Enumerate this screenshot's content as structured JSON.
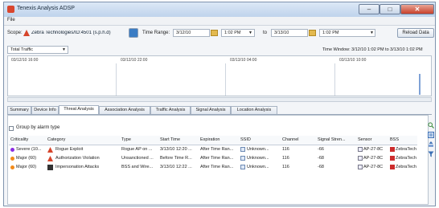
{
  "window": {
    "title": "Tenexis Analysis ADSP"
  },
  "menu": {
    "file": "File"
  },
  "toolbar": {
    "scope_label": "Scope:",
    "scope_value": "Zebra Technologies/ID:4501 (s.p.h.d)",
    "time_range_label": "Time Range:",
    "from_date": "3/12/10",
    "from_time": "1:02 PM",
    "to_label": "to",
    "to_date": "3/13/10",
    "to_time": "1:02 PM",
    "reload_label": "Reload Data"
  },
  "filter": {
    "value": "Total Traffic"
  },
  "time_window": "Time Window: 3/12/10 1:02 PM to 3/13/10 1:02 PM",
  "timeline": {
    "ticks": [
      "03/12/10 16:00",
      "03/12/10 22:00",
      "03/13/10 04:00",
      "03/13/10 10:00"
    ]
  },
  "tabs": [
    "Summary",
    "Device Info",
    "Threat Analysis",
    "Association Analysis",
    "Traffic Analysis",
    "Signal Analysis",
    "Location Analysis"
  ],
  "group_by": "Group by alarm type",
  "table": {
    "columns": [
      "Criticality",
      "Category",
      "Type",
      "Start Time",
      "Expiration",
      "SSID",
      "Channel",
      "Signal Stren...",
      "Sensor",
      "BSS"
    ],
    "rows": [
      {
        "criticality": "Severe (10...",
        "category": "Rogue Exploit",
        "type": "Rogue AP on ...",
        "start": "3/13/10 12:20 ...",
        "expiration": "After Time Ran...",
        "ssid": "Unknown...",
        "channel": "116",
        "signal": "-66",
        "sensor": "AP-27-8C",
        "bss": "ZebraTech"
      },
      {
        "criticality": "Major (60)",
        "category": "Authorization Violation",
        "type": "Unsanctioned ...",
        "start": "Before Time R...",
        "expiration": "After Time Ran...",
        "ssid": "Unknown...",
        "channel": "116",
        "signal": "-68",
        "sensor": "AP-27-8C",
        "bss": "ZebraTech"
      },
      {
        "criticality": "Major (60)",
        "category": "Impersonation Attacks",
        "type": "BSS and Wire...",
        "start": "3/13/10 12:22 ...",
        "expiration": "After Time Ran...",
        "ssid": "Unknown...",
        "channel": "116",
        "signal": "-68",
        "sensor": "AP-27-8C",
        "bss": "ZebraTech"
      }
    ]
  },
  "colors": {
    "severe": "#8a2be2",
    "major": "#f28a1a",
    "accent": "#3a6fb5"
  },
  "icons": [
    "app-icon",
    "scope-icon",
    "calendar-icon",
    "search-icon",
    "list-icon",
    "export-icon",
    "filter-icon"
  ]
}
